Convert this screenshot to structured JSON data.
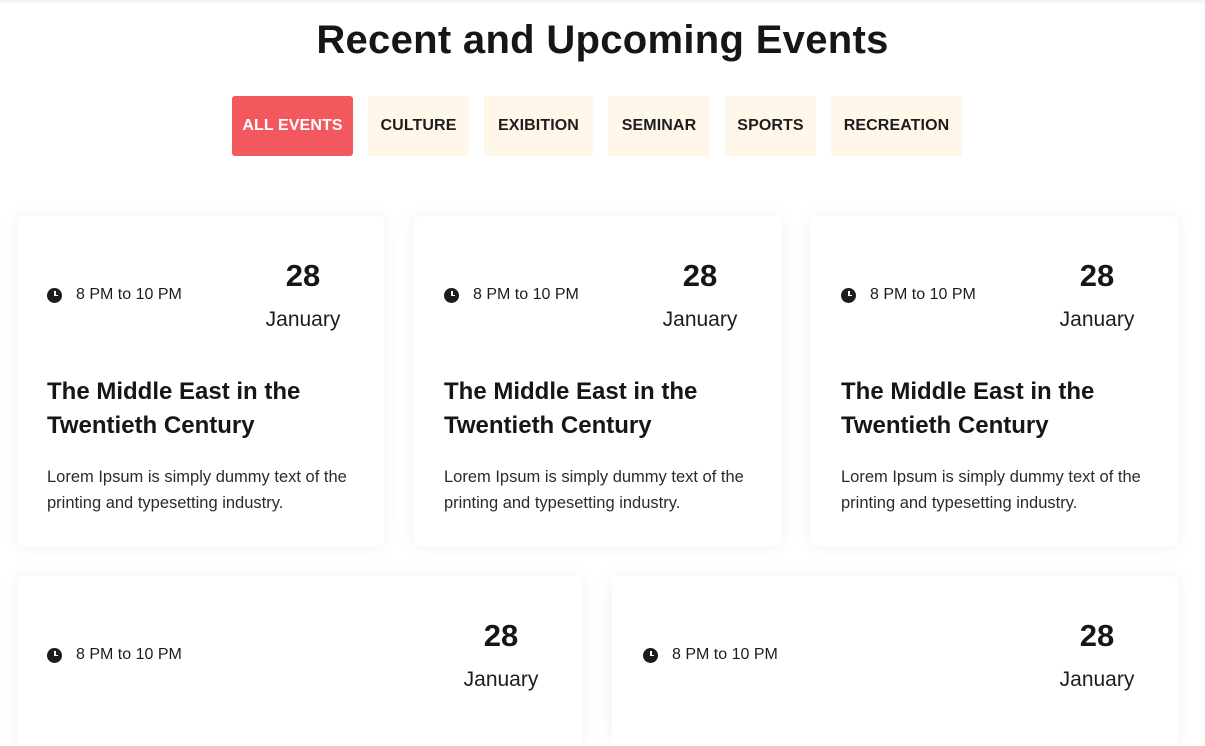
{
  "page": {
    "title": "Recent and Upcoming Events"
  },
  "filters": [
    {
      "label": "ALL EVENTS",
      "active": true
    },
    {
      "label": "CULTURE",
      "active": false
    },
    {
      "label": "EXIBITION",
      "active": false
    },
    {
      "label": "SEMINAR",
      "active": false
    },
    {
      "label": "SPORTS",
      "active": false
    },
    {
      "label": "RECREATION",
      "active": false
    }
  ],
  "colors": {
    "accent": "#f4585f",
    "filter_bg": "#fff7ea",
    "text": "#161616"
  },
  "events": [
    {
      "time": "8 PM to 10 PM",
      "day": "28",
      "month": "January",
      "title": "The Middle East in the Twentieth Century",
      "description": "Lorem Ipsum is simply dummy text of the printing and typesetting industry."
    },
    {
      "time": "8 PM to 10 PM",
      "day": "28",
      "month": "January",
      "title": "The Middle East in the Twentieth Century",
      "description": "Lorem Ipsum is simply dummy text of the printing and typesetting industry."
    },
    {
      "time": "8 PM to 10 PM",
      "day": "28",
      "month": "January",
      "title": "The Middle East in the Twentieth Century",
      "description": "Lorem Ipsum is simply dummy text of the printing and typesetting industry."
    },
    {
      "time": "8 PM to 10 PM",
      "day": "28",
      "month": "January"
    },
    {
      "time": "8 PM to 10 PM",
      "day": "28",
      "month": "January"
    }
  ]
}
